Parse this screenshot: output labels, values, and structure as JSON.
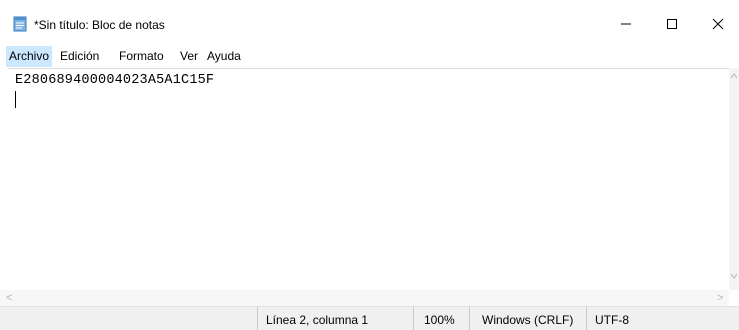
{
  "window": {
    "title": "*Sin título: Bloc de notas",
    "app_icon": "notepad-icon",
    "controls": {
      "minimize": "–",
      "maximize": "☐",
      "close": "✕"
    }
  },
  "menubar": {
    "items": [
      {
        "label": "Archivo"
      },
      {
        "label": "Edición"
      },
      {
        "label": "Formato"
      },
      {
        "label": "Ver"
      },
      {
        "label": "Ayuda"
      }
    ]
  },
  "editor": {
    "lines": [
      "E280689400004023A5A1C15F",
      ""
    ]
  },
  "scrollbars": {
    "left_arrow": "<",
    "right_arrow": ">"
  },
  "statusbar": {
    "position": "Línea 2, columna 1",
    "zoom": "100%",
    "line_ending": "Windows (CRLF)",
    "encoding": "UTF-8"
  }
}
